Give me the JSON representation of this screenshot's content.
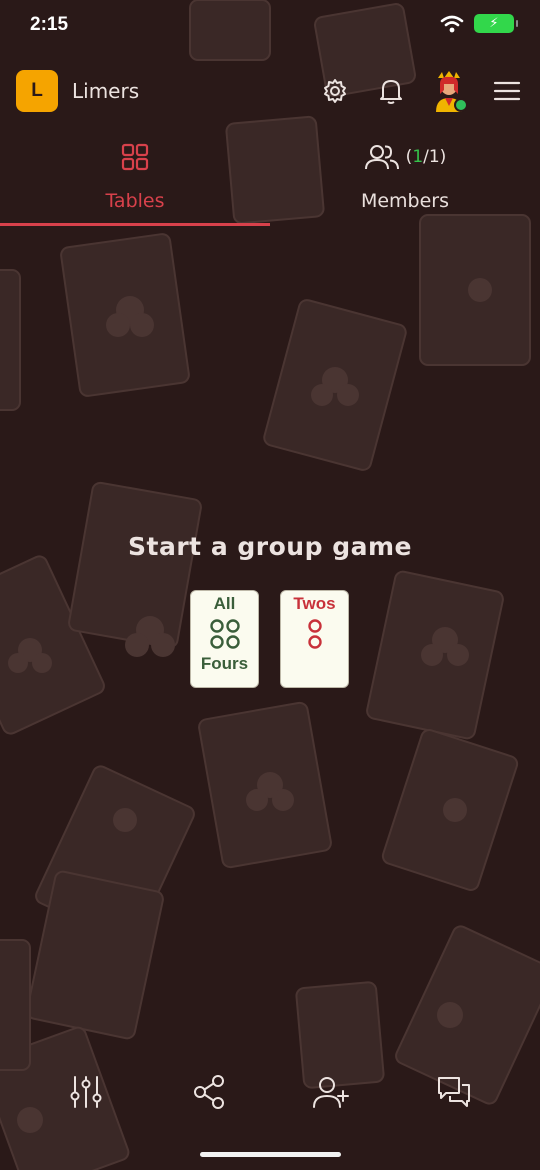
{
  "status_bar": {
    "time": "2:15"
  },
  "header": {
    "group_initial": "L",
    "group_name": "Limers",
    "icons": [
      "settings-icon",
      "bell-icon",
      "user-avatar",
      "menu-icon"
    ]
  },
  "tabs": [
    {
      "label": "Tables",
      "icon": "grid-icon",
      "active": true
    },
    {
      "label": "Members",
      "icon": "users-icon",
      "active": false,
      "count_online": "1",
      "count_total": "/1)",
      "count_open": "("
    }
  ],
  "main": {
    "title": "Start a group game",
    "game_options": [
      {
        "top": "All",
        "bottom": "Fours",
        "color": "#3a5e3a"
      },
      {
        "top": "Twos",
        "bottom": "",
        "color": "#c8313a"
      }
    ]
  },
  "toolbar": {
    "icons": [
      "sliders-icon",
      "share-icon",
      "add-user-icon",
      "chat-icon"
    ]
  },
  "colors": {
    "background": "#2a1918",
    "accent": "#d8414b",
    "group_avatar": "#f5a400",
    "online": "#35c24a"
  }
}
